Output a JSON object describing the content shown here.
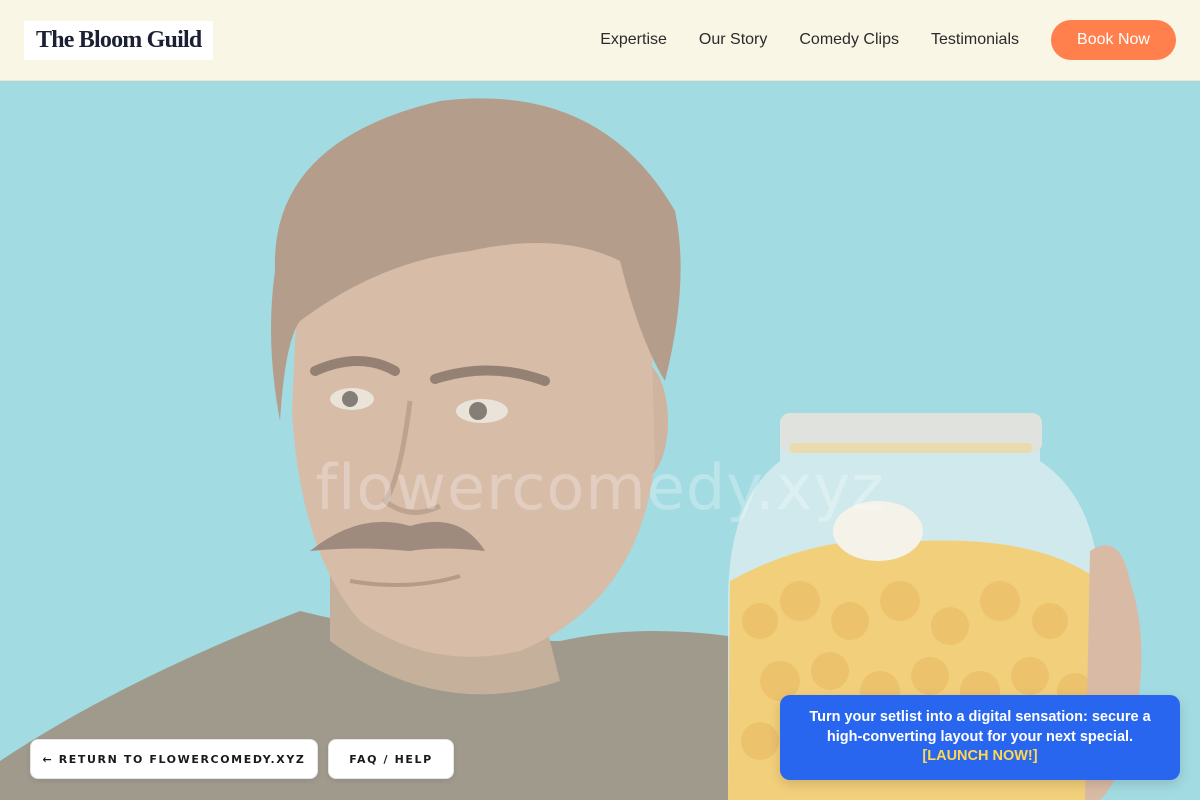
{
  "header": {
    "logo": "The Bloom Guild",
    "nav": [
      "Expertise",
      "Our Story",
      "Comedy Clips",
      "Testimonials"
    ],
    "cta": "Book Now"
  },
  "hero": {
    "watermark": "flowercomedy.xyz",
    "background_color": "#8fd3dc"
  },
  "footer_buttons": {
    "return_label": "← RETURN TO FLOWERCOMEDY.XYZ",
    "faq_label": "FAQ / HELP"
  },
  "promo": {
    "text": "Turn your setlist into a digital sensation: secure a high-converting layout for your next special.",
    "cta": "[LAUNCH NOW!]"
  },
  "colors": {
    "accent": "#ff7f4d",
    "promo_bg": "#2966f0",
    "promo_cta": "#ffd84d",
    "header_bg": "#f9f6e6"
  }
}
